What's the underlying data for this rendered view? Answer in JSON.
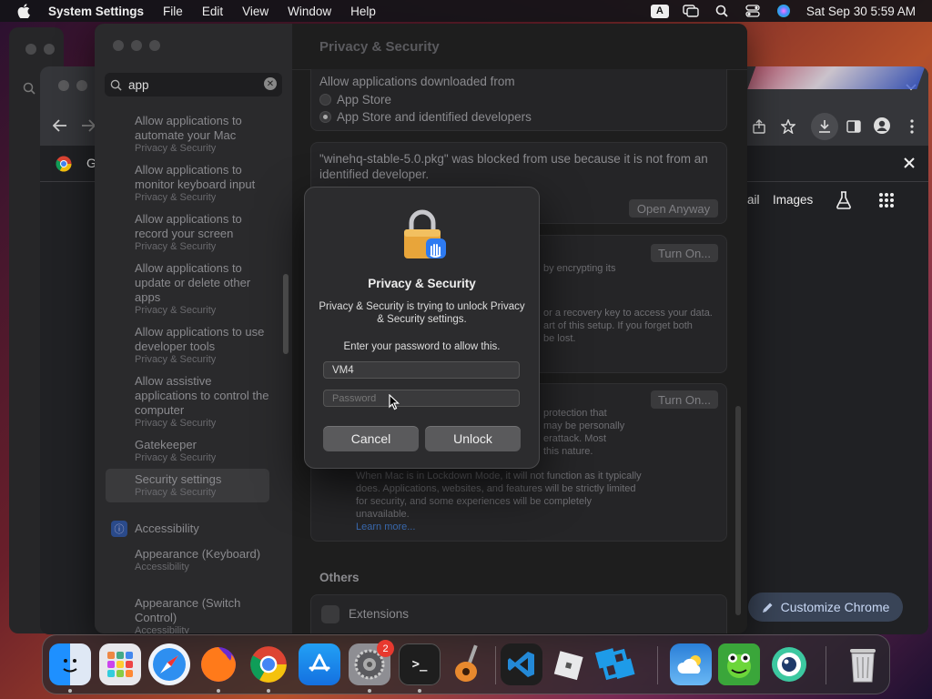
{
  "menubar": {
    "app": "System Settings",
    "items": [
      "File",
      "Edit",
      "View",
      "Window",
      "Help"
    ],
    "input_indicator": "A",
    "clock": "Sat Sep 30  5:59 AM"
  },
  "chrome": {
    "tab_letter": "G",
    "links": [
      "ail",
      "Images"
    ],
    "customize_label": "Customize Chrome"
  },
  "settings": {
    "search_value": "app",
    "results": [
      {
        "title": "Allow applications to automate your Mac",
        "sub": "Privacy & Security"
      },
      {
        "title": "Allow applications to monitor keyboard input",
        "sub": "Privacy & Security"
      },
      {
        "title": "Allow applications to record your screen",
        "sub": "Privacy & Security"
      },
      {
        "title": "Allow applications to update or delete other apps",
        "sub": "Privacy & Security"
      },
      {
        "title": "Allow applications to use developer tools",
        "sub": "Privacy & Security"
      },
      {
        "title": "Allow assistive applications to control the computer",
        "sub": "Privacy & Security"
      },
      {
        "title": "Gatekeeper",
        "sub": "Privacy & Security"
      },
      {
        "title": "Security settings",
        "sub": "Privacy & Security"
      },
      {
        "title": "Accessibility",
        "sub": ""
      },
      {
        "title": "Appearance (Keyboard)",
        "sub": "Accessibility"
      },
      {
        "title": "Appearance (Switch Control)",
        "sub": "Accessibility"
      }
    ],
    "main_title": "Privacy & Security",
    "allow_label": "Allow applications downloaded from",
    "radio_app_store": "App Store",
    "radio_identified": "App Store and identified developers",
    "blocked_msg": "\"winehq-stable-5.0.pkg\" was blocked from use because it is not from an identified developer.",
    "open_anyway": "Open Anyway",
    "turn_on_1": "Turn On...",
    "filevault_frag_1": "by encrypting its",
    "filevault_frag_2": "or a recovery key to access your data.",
    "filevault_frag_3": "art of this setup. If you forget both",
    "filevault_frag_4": "be lost.",
    "turn_on_2": "Turn On...",
    "lockdown_frag_1": "protection that",
    "lockdown_frag_2": "may be personally",
    "lockdown_frag_3": "erattack. Most",
    "lockdown_frag_4": "this nature.",
    "lockdown_body": "When Mac is in Lockdown Mode, it will not function as it typically does. Applications, websites, and features will be strictly limited for security, and some experiences will be completely unavailable.",
    "learn_more": "Learn more...",
    "others": "Others",
    "extensions": "Extensions"
  },
  "dialog": {
    "title": "Privacy & Security",
    "message": "Privacy & Security is trying to unlock Privacy & Security settings.",
    "prompt": "Enter your password to allow this.",
    "username": "VM4",
    "password_placeholder": "Password",
    "cancel": "Cancel",
    "unlock": "Unlock"
  },
  "dock": {
    "apps": [
      "Finder",
      "Launchpad",
      "Safari",
      "Firefox",
      "Google Chrome",
      "App Store",
      "System Settings",
      "Terminal",
      "GarageBand",
      "Visual Studio Code",
      "Roblox",
      "Roblox Studio",
      "Weather",
      "Frogger",
      "Mirror",
      "Trash"
    ],
    "settings_badge": "2"
  },
  "colors": {
    "accent_blue": "#3a6ab0",
    "badge_red": "#e8392f",
    "dialog_bg": "#2c2c2e"
  }
}
